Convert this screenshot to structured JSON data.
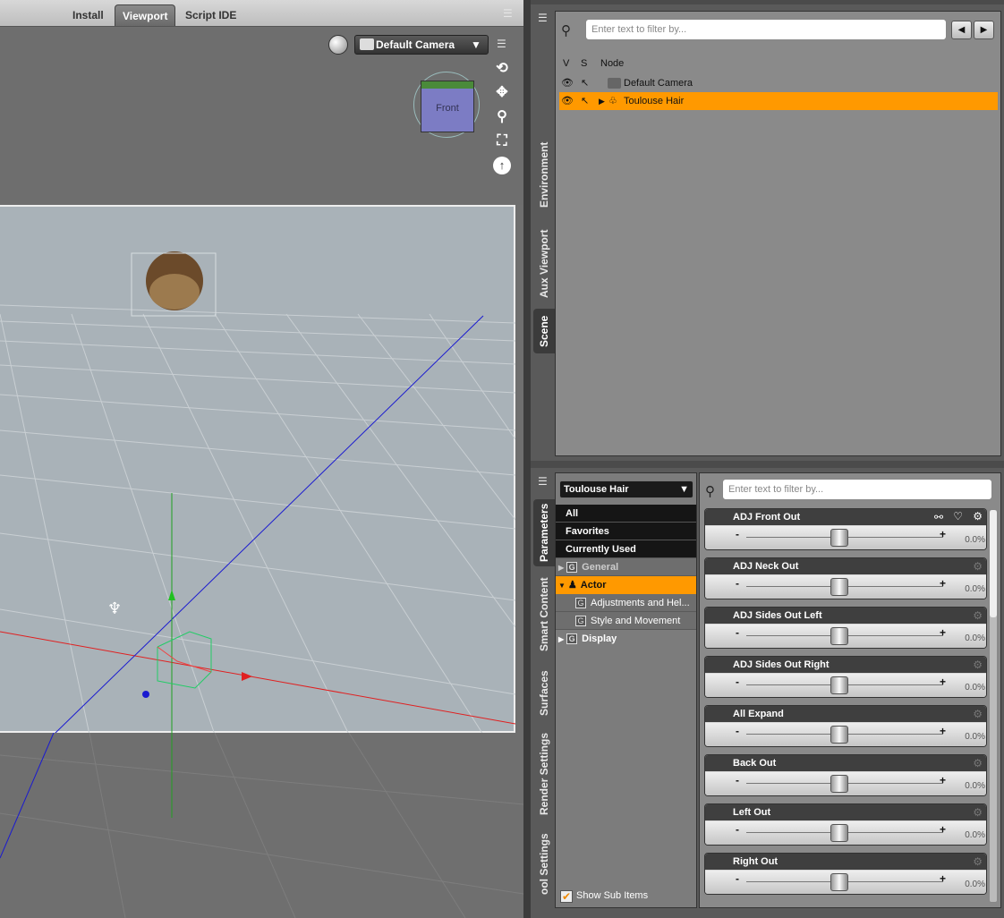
{
  "tabs": [
    {
      "label": "Install"
    },
    {
      "label": "Viewport"
    },
    {
      "label": "Script IDE"
    }
  ],
  "viewport": {
    "camera_label": "Default Camera",
    "cube_label": "Front",
    "icons": [
      "orbit-icon",
      "pan-icon",
      "zoom-icon",
      "frame-icon",
      "reset-icon"
    ]
  },
  "scene": {
    "filter_placeholder": "Enter text to filter by...",
    "vtabs": [
      "Environment",
      "Aux Viewport",
      "Scene"
    ],
    "headers": {
      "v": "V",
      "s": "S",
      "node": "Node"
    },
    "nodes": [
      {
        "label": "Default Camera"
      },
      {
        "label": "Toulouse Hair"
      }
    ]
  },
  "params": {
    "vtabs": [
      "Parameters",
      "Smart Content",
      "Surfaces",
      "Render Settings",
      "ool Settings"
    ],
    "node_select": "Toulouse Hair",
    "filter_placeholder": "Enter text to filter by...",
    "groups": [
      {
        "label": "All"
      },
      {
        "label": "Favorites"
      },
      {
        "label": "Currently Used"
      },
      {
        "label": "General"
      },
      {
        "label": "Actor"
      },
      {
        "label": "Adjustments and Hel..."
      },
      {
        "label": "Style and Movement"
      },
      {
        "label": "Display"
      }
    ],
    "show_sub_items": "Show Sub Items",
    "sliders": [
      {
        "label": "ADJ Front Out",
        "value": "0.0%"
      },
      {
        "label": "ADJ Neck Out",
        "value": "0.0%"
      },
      {
        "label": "ADJ Sides Out Left",
        "value": "0.0%"
      },
      {
        "label": "ADJ Sides Out Right",
        "value": "0.0%"
      },
      {
        "label": "All Expand",
        "value": "0.0%"
      },
      {
        "label": "Back Out",
        "value": "0.0%"
      },
      {
        "label": "Left Out",
        "value": "0.0%"
      },
      {
        "label": "Right Out",
        "value": "0.0%"
      }
    ]
  },
  "colors": {
    "accent": "#ff9900",
    "panel": "#5a5a5a",
    "canvas": "#a9b2b8"
  }
}
